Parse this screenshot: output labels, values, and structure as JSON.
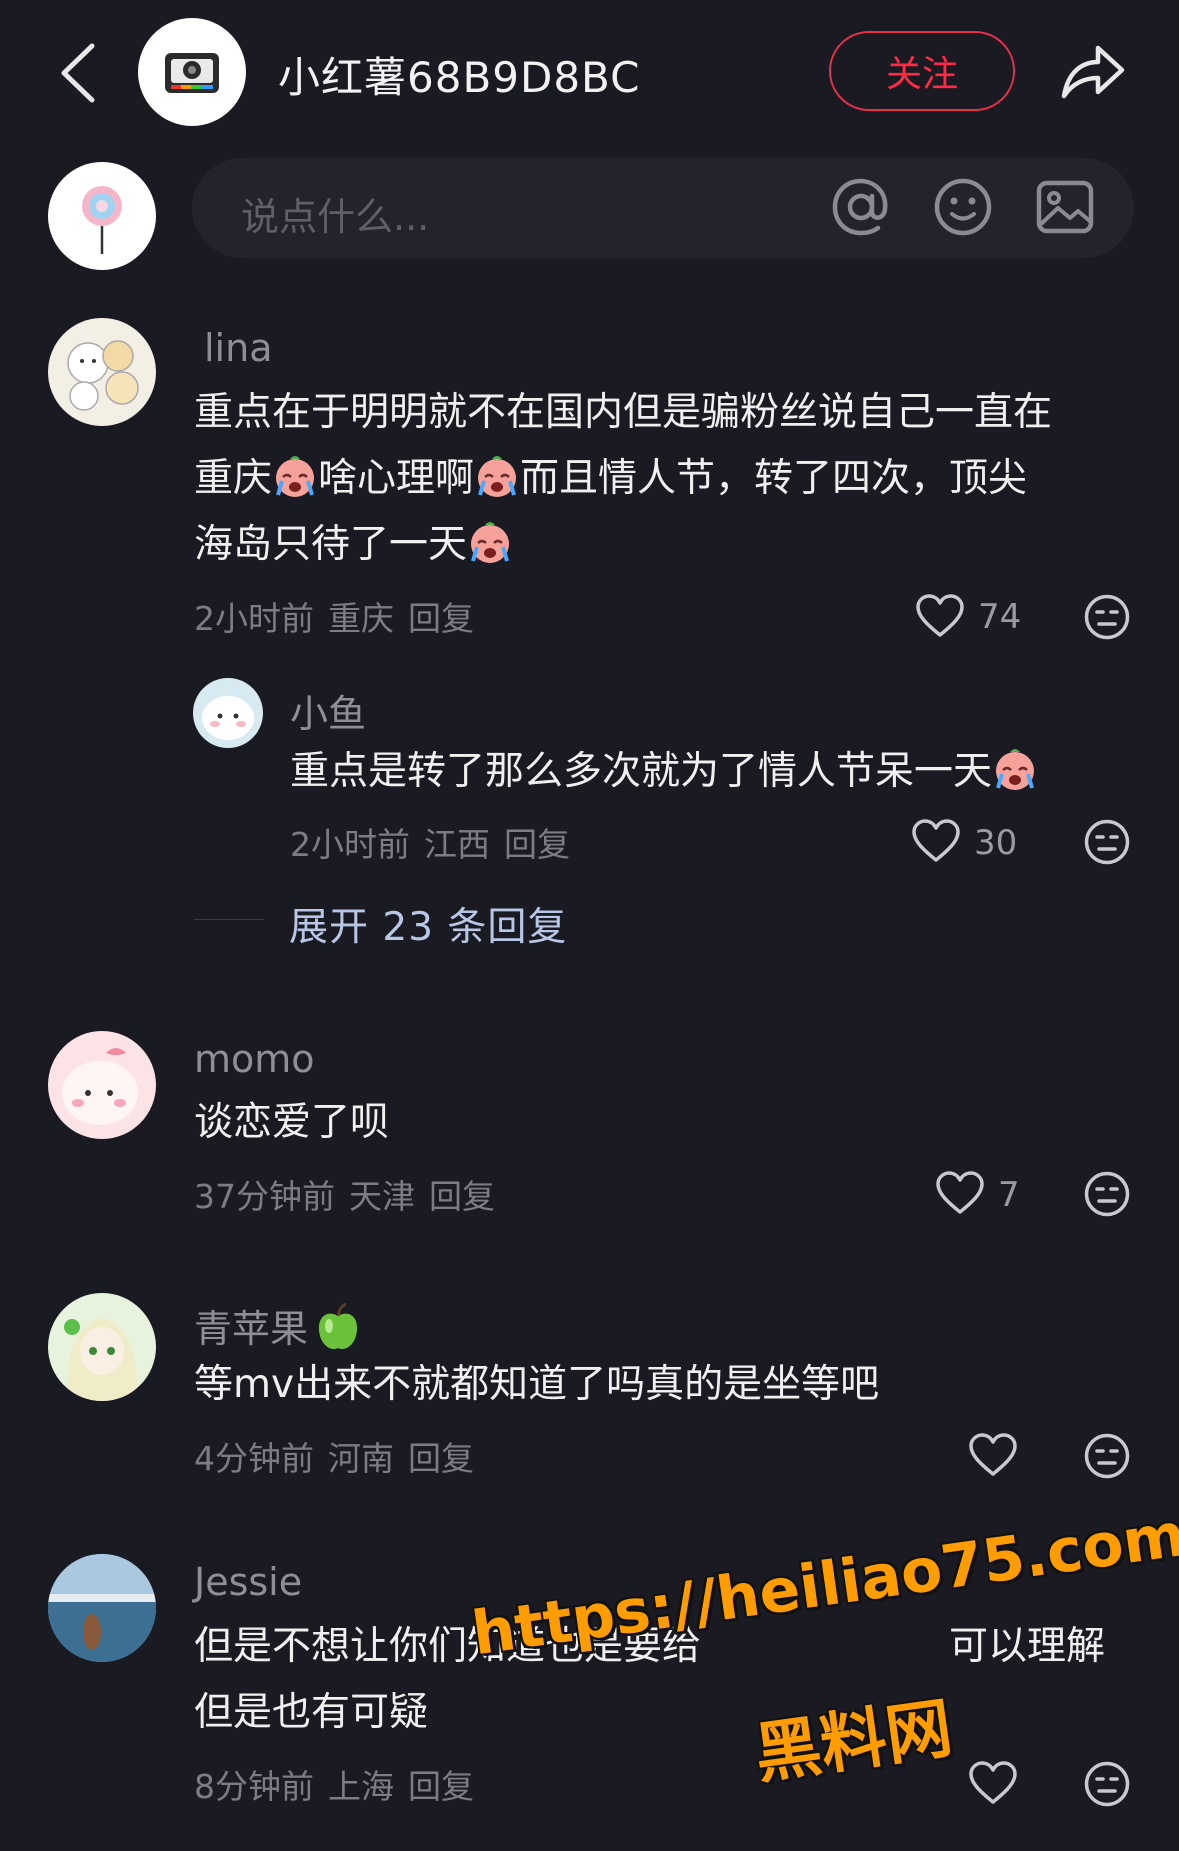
{
  "header": {
    "title": "小红薯68B9D8BC",
    "follow_label": "关注"
  },
  "composer": {
    "placeholder": "说点什么..."
  },
  "comments": [
    {
      "user": "lina",
      "text_parts": [
        "重点在于明明就不在国内但是骗粉丝说自己一直在",
        "重庆",
        "啥心理啊",
        "而且情人节，转了四次，顶尖",
        "海岛只待了一天"
      ],
      "time": "2小时前",
      "location": "重庆",
      "reply_label": "回复",
      "likes": "74"
    },
    {
      "user": "小鱼",
      "text": "重点是转了那么多次就为了情人节呆一天",
      "time": "2小时前",
      "location": "江西",
      "reply_label": "回复",
      "likes": "30"
    },
    {
      "user": "momo",
      "text": "谈恋爱了呗",
      "time": "37分钟前",
      "location": "天津",
      "reply_label": "回复",
      "likes": "7"
    },
    {
      "user": "青苹果",
      "text": "等mv出来不就都知道了吗真的是坐等吧",
      "time": "4分钟前",
      "location": "河南",
      "reply_label": "回复"
    },
    {
      "user": "Jessie",
      "line1": "但是不想让你们知道也是要给",
      "line1_tail": "可以理解",
      "line2": "但是也有可疑",
      "time": "8分钟前",
      "location": "上海",
      "reply_label": "回复"
    }
  ],
  "expand_replies": "展开 23 条回复",
  "watermark": {
    "url": "https://heiliao75.com",
    "name": "黑料网"
  },
  "colors": {
    "background": "#1a1a22",
    "accent_red": "#ff2a45",
    "watermark": "#ff9d00"
  }
}
